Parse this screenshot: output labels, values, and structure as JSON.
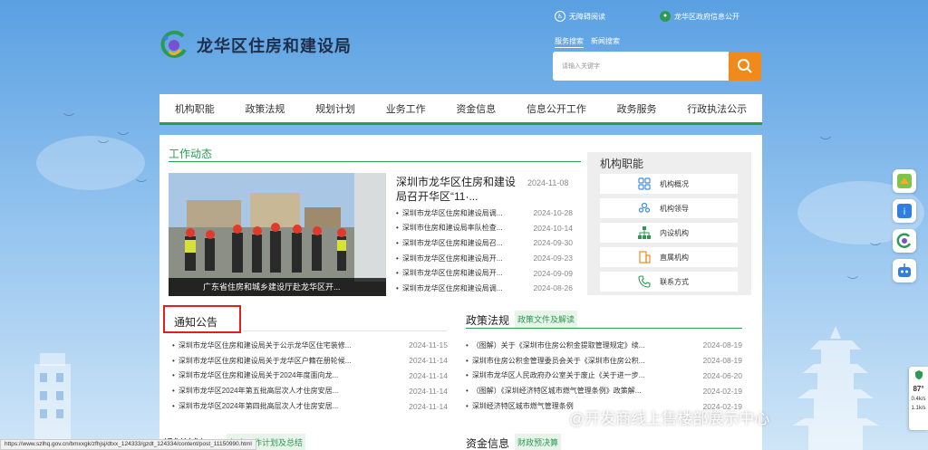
{
  "header": {
    "site_title": "龙华区住房和建设局",
    "accessibility_label": "无障碍阅读",
    "gov_info_label": "龙华区政府信息公开",
    "search_tabs": [
      "服务搜索",
      "新闻搜索"
    ],
    "search_placeholder": "请输入关键字"
  },
  "nav": {
    "items": [
      "机构职能",
      "政策法规",
      "规划计划",
      "业务工作",
      "资金信息",
      "信息公开工作",
      "政务服务",
      "行政执法公示"
    ]
  },
  "work_news": {
    "title": "工作动态",
    "photo_caption": "广东省住房和城乡建设厅赴龙华区开...",
    "headline": "深圳市龙华区住房和建设局召开华区“11·...",
    "headline_date": "2024-11-08",
    "items": [
      {
        "text": "深圳市龙华区住房和建设局调...",
        "date": "2024-10-28"
      },
      {
        "text": "深圳市住房和建设局率队检查...",
        "date": "2024-10-14"
      },
      {
        "text": "深圳市龙华区住房和建设局召...",
        "date": "2024-09-30"
      },
      {
        "text": "深圳市龙华区住房和建设局开...",
        "date": "2024-09-23"
      },
      {
        "text": "深圳市龙华区住房和建设局开...",
        "date": "2024-09-09"
      },
      {
        "text": "深圳市龙华区住房和建设局调...",
        "date": "2024-08-26"
      }
    ]
  },
  "org": {
    "title": "机构职能",
    "items": [
      "机构概况",
      "机构领导",
      "内设机构",
      "直属机构",
      "联系方式"
    ]
  },
  "notices": {
    "title": "通知公告",
    "items": [
      {
        "text": "深圳市龙华区住房和建设局关于公示龙华区住宅装修...",
        "date": "2024-11-15"
      },
      {
        "text": "深圳市龙华区住房和建设局关于龙华区户籍在册轮候...",
        "date": "2024-11-14"
      },
      {
        "text": "深圳市龙华区住房和建设局关于2024年度面向龙...",
        "date": "2024-11-14"
      },
      {
        "text": "深圳市龙华区2024年第五批高层次人才住房安居...",
        "date": "2024-11-14"
      },
      {
        "text": "深圳市龙华区2024年第四批高层次人才住房安居...",
        "date": "2024-11-14"
      }
    ]
  },
  "policy": {
    "title": "政策法规",
    "tag": "政策文件及解读",
    "items": [
      {
        "text": "（图解）关于《深圳市住房公积金提取管理规定》续...",
        "date": "2024-08-19"
      },
      {
        "text": "深圳市住房公积金管理委员会关于《深圳市住房公积...",
        "date": "2024-08-19"
      },
      {
        "text": "深圳市龙华区人民政府办公室关于废止《关于进一步...",
        "date": "2024-06-20"
      },
      {
        "text": "（图解）《深圳经济特区城市燃气管理条例》政策解...",
        "date": "2024-02-19"
      },
      {
        "text": "深圳经济特区城市燃气管理条例",
        "date": "2024-02-19"
      }
    ]
  },
  "bottom": {
    "plan_title": "规划计划",
    "plan_tag": "年度工作计划及总结",
    "fund_title": "资金信息",
    "fund_tag": "财政预决算"
  },
  "status_url": "https://www.szlhq.gov.cn/bmxxgk/zfhjsj/dtxx_124333/gzdt_124334/content/post_11150990.html",
  "watermark": "@开发商线上售楼部展示中心",
  "widget": {
    "value": "87",
    "unit": "°",
    "l1": "0.4k/s",
    "l2": "1.1k/s"
  },
  "colors": {
    "brand_green": "#2c9a52",
    "search_orange": "#f08a1c",
    "highlight_red": "#e02020"
  }
}
